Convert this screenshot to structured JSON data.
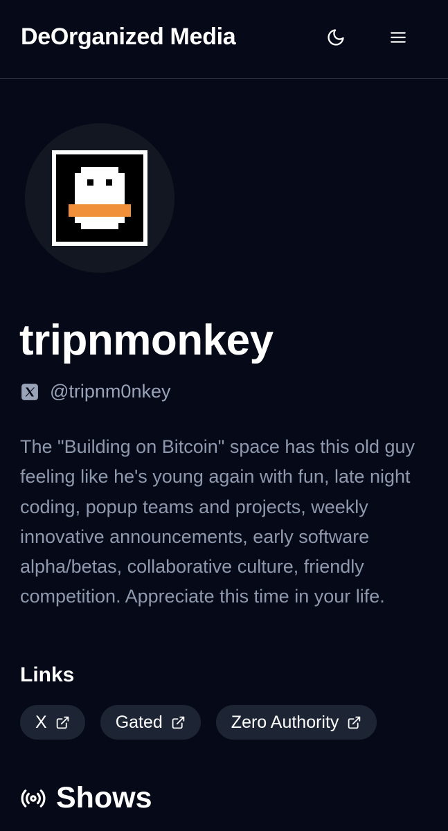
{
  "header": {
    "brand": "DeOrganized Media",
    "theme_icon": "moon-icon",
    "menu_icon": "hamburger-menu-icon"
  },
  "profile": {
    "avatar_icon": "pixel-duck-avatar",
    "username": "tripnmonkey",
    "handle": "@tripnm0nkey",
    "handle_icon": "x-logo-icon",
    "bio": "The \"Building on Bitcoin\" space has this old guy feeling like he's young again with fun, late night coding, popup teams and projects, weekly innovative announcements, early software alpha/betas, collaborative culture, friendly competition. Appreciate this time in your life."
  },
  "links": {
    "title": "Links",
    "items": [
      {
        "label": "X",
        "icon": "external-link-icon"
      },
      {
        "label": "Gated",
        "icon": "external-link-icon"
      },
      {
        "label": "Zero Authority",
        "icon": "external-link-icon"
      }
    ]
  },
  "shows": {
    "title": "Shows",
    "icon": "broadcast-icon"
  },
  "colors": {
    "background": "#060a18",
    "chip": "#1d2535",
    "muted_text": "#8f99ad",
    "duck_beak": "#f0903a"
  }
}
